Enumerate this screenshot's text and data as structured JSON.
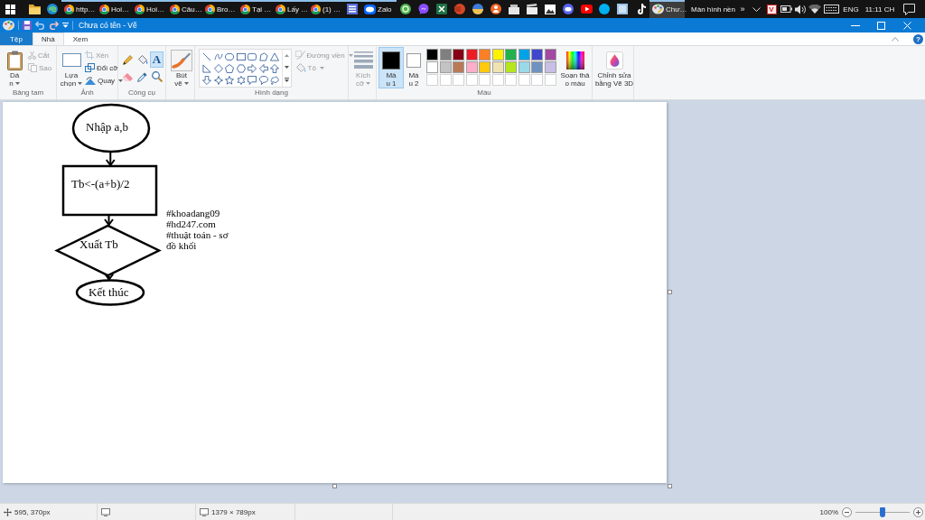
{
  "taskbar": {
    "apps": [
      {
        "kind": "folder",
        "running": false,
        "selected": false
      },
      {
        "kind": "swirl",
        "running": false,
        "selected": false
      },
      {
        "kind": "wheel",
        "label": "http…",
        "running": true,
        "selected": false
      },
      {
        "kind": "wheel",
        "label": "Hoi…",
        "running": true,
        "selected": false
      },
      {
        "kind": "wheel",
        "label": "Hoi…",
        "running": true,
        "selected": false
      },
      {
        "kind": "wheel",
        "label": "Câu…",
        "running": true,
        "selected": false
      },
      {
        "kind": "wheel",
        "label": "Bro…",
        "running": true,
        "selected": false
      },
      {
        "kind": "wheel",
        "label": "Tại …",
        "running": true,
        "selected": false
      },
      {
        "kind": "wheel",
        "label": "Lấy …",
        "running": true,
        "selected": false
      },
      {
        "kind": "wheel",
        "label": "(1) …",
        "running": true,
        "selected": false
      },
      {
        "kind": "panel",
        "running": true,
        "selected": false
      },
      {
        "kind": "bubble",
        "label": "Zalo",
        "running": true,
        "selected": false
      },
      {
        "kind": "orb",
        "running": false,
        "selected": false
      },
      {
        "kind": "chat",
        "running": false,
        "selected": false
      },
      {
        "kind": "sheet",
        "running": false,
        "selected": false
      },
      {
        "kind": "slides",
        "running": false,
        "selected": false
      },
      {
        "kind": "globe",
        "running": false,
        "selected": false
      },
      {
        "kind": "person",
        "running": false,
        "selected": false
      },
      {
        "kind": "box",
        "running": false,
        "selected": false
      },
      {
        "kind": "clapper",
        "running": false,
        "selected": false
      },
      {
        "kind": "photo",
        "running": false,
        "selected": false
      },
      {
        "kind": "gamepad",
        "running": false,
        "selected": false
      },
      {
        "kind": "play",
        "running": false,
        "selected": false
      },
      {
        "kind": "disc",
        "running": false,
        "selected": false
      },
      {
        "kind": "square",
        "running": false,
        "selected": false
      },
      {
        "kind": "note",
        "running": false,
        "selected": false
      },
      {
        "kind": "palette",
        "label": "Chư…",
        "running": true,
        "selected": true
      }
    ],
    "desktop_toolbar": {
      "label": "Màn hình nền",
      "more": "»"
    },
    "input_method": "V",
    "language": "ENG",
    "clock": "11:11 CH"
  },
  "window": {
    "title": "Chưa có tên - Vẽ"
  },
  "ribbon": {
    "file_tab": "Tệp",
    "tabs": [
      {
        "label": "Nhà",
        "selected": true
      },
      {
        "label": "Xem",
        "selected": false
      }
    ],
    "help": "?",
    "clipboard": {
      "label": "Bảng tam",
      "paste": {
        "lines": [
          "Dá",
          "n"
        ],
        "dropdown": true,
        "disabled": false
      },
      "cut": {
        "label": "Cắt",
        "disabled": true
      },
      "copy": {
        "label": "Sao",
        "disabled": true
      }
    },
    "image": {
      "label": "Ảnh",
      "select": {
        "lines": [
          "Lựa",
          "chọn"
        ],
        "dropdown": true,
        "disabled": false
      },
      "crop": {
        "label": "Xén",
        "disabled": true
      },
      "resize": {
        "label": "Đổi cỡ",
        "disabled": false
      },
      "rotate": {
        "label": "Quay",
        "dropdown": true,
        "disabled": false
      }
    },
    "tools": {
      "label": "Công cụ",
      "items": [
        {
          "kind": "pencil",
          "selected": false
        },
        {
          "kind": "fill",
          "selected": false
        },
        {
          "kind": "text",
          "glyph": "A",
          "selected": true
        },
        {
          "kind": "eraser",
          "selected": false
        },
        {
          "kind": "picker",
          "selected": false
        },
        {
          "kind": "magnifier",
          "selected": false
        }
      ]
    },
    "brushes": {
      "lines": [
        "Bút",
        "vẽ"
      ],
      "dropdown": true,
      "disabled": false
    },
    "shapes": {
      "label": "Hình dạng",
      "outline": {
        "label": "Đường viền",
        "dropdown": true,
        "disabled": true
      },
      "fill": {
        "label": "Tô",
        "dropdown": true,
        "disabled": true
      }
    },
    "size": {
      "lines": [
        "Kích",
        "cỡ"
      ],
      "dropdown": true,
      "disabled": true
    },
    "colors": {
      "label": "Màu",
      "color1": {
        "lines": [
          "Mà",
          "u 1"
        ],
        "color": "#000000",
        "selected": true
      },
      "color2": {
        "lines": [
          "Mà",
          "u 2"
        ],
        "color": "#ffffff",
        "selected": false
      },
      "palette": [
        {
          "kind": "swatch",
          "color": "#000000"
        },
        {
          "kind": "swatch",
          "color": "#7f7f7f"
        },
        {
          "kind": "swatch",
          "color": "#880015"
        },
        {
          "kind": "swatch",
          "color": "#ed1c24"
        },
        {
          "kind": "swatch",
          "color": "#ff7f27"
        },
        {
          "kind": "swatch",
          "color": "#fff200"
        },
        {
          "kind": "swatch",
          "color": "#22b14c"
        },
        {
          "kind": "swatch",
          "color": "#00a2e8"
        },
        {
          "kind": "swatch",
          "color": "#3f48cc"
        },
        {
          "kind": "swatch",
          "color": "#a349a4"
        },
        {
          "kind": "swatch",
          "color": "#ffffff"
        },
        {
          "kind": "swatch",
          "color": "#c3c3c3"
        },
        {
          "kind": "swatch",
          "color": "#b97a57"
        },
        {
          "kind": "swatch",
          "color": "#ffaec9"
        },
        {
          "kind": "swatch",
          "color": "#ffc90e"
        },
        {
          "kind": "swatch",
          "color": "#efe4b0"
        },
        {
          "kind": "swatch",
          "color": "#b5e61d"
        },
        {
          "kind": "swatch",
          "color": "#99d9ea"
        },
        {
          "kind": "swatch",
          "color": "#7092be"
        },
        {
          "kind": "swatch",
          "color": "#c8bfe7"
        },
        {
          "kind": "empty"
        },
        {
          "kind": "empty"
        },
        {
          "kind": "empty"
        },
        {
          "kind": "empty"
        },
        {
          "kind": "empty"
        },
        {
          "kind": "empty"
        },
        {
          "kind": "empty"
        },
        {
          "kind": "empty"
        },
        {
          "kind": "empty"
        },
        {
          "kind": "empty"
        }
      ],
      "edit": {
        "lines": [
          "Soạn thả",
          "o màu"
        ]
      }
    },
    "paint3d": {
      "lines": [
        "Chỉnh sửa",
        "bằng Vẽ 3D"
      ]
    }
  },
  "drawing": {
    "nodes": [
      {
        "kind": "oval",
        "text": "Nhập a,b"
      },
      {
        "kind": "rectangle",
        "text": "Tb<-(a+b)/2"
      },
      {
        "kind": "diamond",
        "text": "Xuất Tb"
      },
      {
        "kind": "oval",
        "text": "Kết thúc"
      }
    ],
    "note": [
      "#khoadang09",
      "#hd247.com",
      "#thuật toán - sơ",
      "đồ khối"
    ]
  },
  "status_bar": {
    "cursor": "595, 370px",
    "canvas_size": "1379 × 789px",
    "zoom": "100%",
    "zoom_slider": {
      "level": 0.5
    }
  }
}
